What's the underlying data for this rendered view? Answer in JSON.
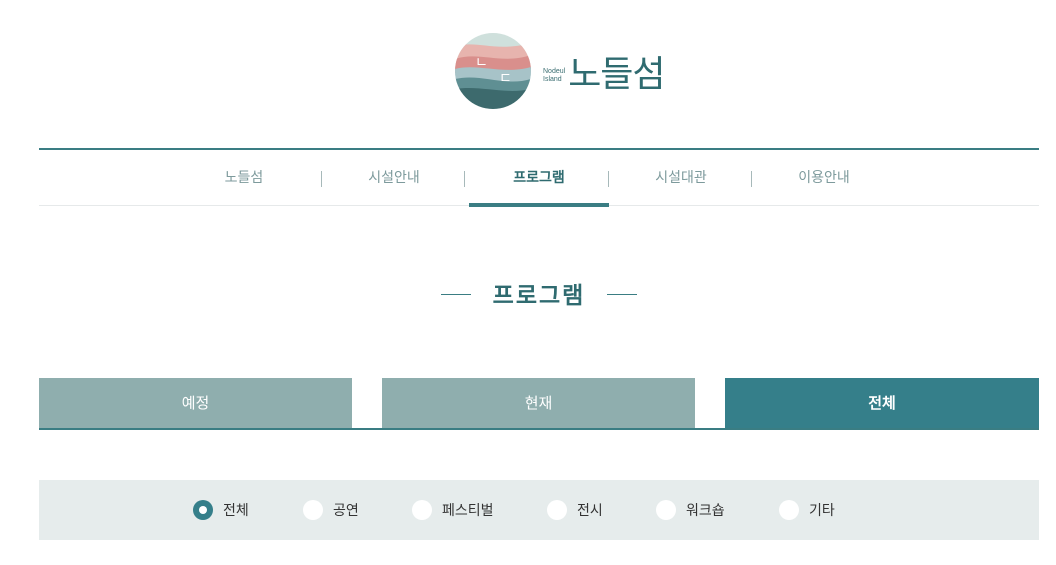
{
  "brand": {
    "name": "노들섬",
    "sub_line1": "Nodeul",
    "sub_line2": "Island",
    "logo_glyph_top": "ㄴ",
    "logo_glyph_right": "ㄷ"
  },
  "nav": {
    "items": [
      {
        "label": "노들섬"
      },
      {
        "label": "시설안내"
      },
      {
        "label": "프로그램",
        "active": true
      },
      {
        "label": "시설대관"
      },
      {
        "label": "이용안내"
      }
    ]
  },
  "page": {
    "title": "프로그램"
  },
  "tabs": [
    {
      "label": "예정"
    },
    {
      "label": "현재"
    },
    {
      "label": "전체",
      "active": true
    }
  ],
  "filters": [
    {
      "label": "전체",
      "checked": true
    },
    {
      "label": "공연"
    },
    {
      "label": "페스티벌"
    },
    {
      "label": "전시"
    },
    {
      "label": "워크숍"
    },
    {
      "label": "기타"
    }
  ],
  "colors": {
    "primary": "#357f8a",
    "tab_inactive": "#8faeae",
    "filter_bg": "#e6ecec",
    "nav_inactive": "#7d9a9c"
  }
}
